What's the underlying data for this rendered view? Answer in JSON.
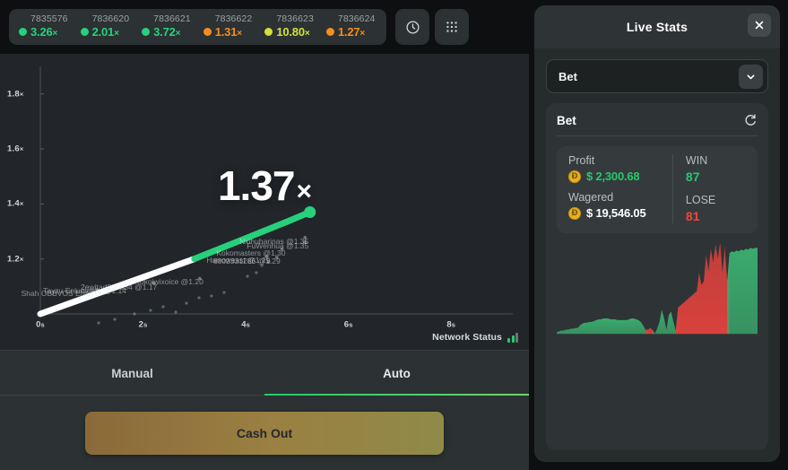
{
  "history": {
    "items": [
      {
        "id": "7835576",
        "multiplier": "3.26",
        "suffix": "×",
        "dot_color": "#27d17c",
        "text_color": "#27d17c"
      },
      {
        "id": "7836620",
        "multiplier": "2.01",
        "suffix": "×",
        "dot_color": "#27d17c",
        "text_color": "#27d17c"
      },
      {
        "id": "7836621",
        "multiplier": "3.72",
        "suffix": "×",
        "dot_color": "#27d17c",
        "text_color": "#27d17c"
      },
      {
        "id": "7836622",
        "multiplier": "1.31",
        "suffix": "×",
        "dot_color": "#f58e1f",
        "text_color": "#f58e1f"
      },
      {
        "id": "7836623",
        "multiplier": "10.80",
        "suffix": "×",
        "dot_color": "#cfe03a",
        "text_color": "#cfe03a"
      },
      {
        "id": "7836624",
        "multiplier": "1.27",
        "suffix": "×",
        "dot_color": "#f58e1f",
        "text_color": "#f58e1f"
      }
    ],
    "history_icon": "clock-icon",
    "grid_icon": "grid-dots-icon"
  },
  "chart_data": {
    "type": "line",
    "title": "1.37×",
    "current_multiplier": "1.37",
    "multiplier_suffix": "×",
    "xlabel": "",
    "ylabel": "",
    "x_ticks": [
      "0s",
      "2s",
      "4s",
      "6s",
      "8s"
    ],
    "x_tick_values": [
      0,
      2,
      4,
      6,
      8
    ],
    "y_ticks": [
      "1.2×",
      "1.4×",
      "1.6×",
      "1.8×"
    ],
    "y_tick_values": [
      1.2,
      1.4,
      1.6,
      1.8
    ],
    "xlim": [
      0,
      9.2
    ],
    "ylim": [
      1.0,
      1.9
    ],
    "grid": false,
    "series": [
      {
        "name": "multiplier-curve",
        "color": "#27d17c",
        "x": [
          0,
          0.6,
          1.2,
          1.8,
          2.4,
          3.0,
          3.6,
          4.2,
          4.8,
          5.25
        ],
        "y": [
          1.0,
          1.04,
          1.08,
          1.12,
          1.16,
          1.2,
          1.245,
          1.29,
          1.335,
          1.37
        ]
      }
    ],
    "cashouts": [
      {
        "label": "Nxihuharinas @1.35",
        "x": 5.05,
        "y": 1.265
      },
      {
        "label": "FuWenhua @1.35",
        "x": 5.05,
        "y": 1.248
      },
      {
        "label": "Kokomasters @1.30",
        "x": 4.6,
        "y": 1.222
      },
      {
        "label": "Harroweast @1.29",
        "x": 4.3,
        "y": 1.196
      },
      {
        "label": "8802331286 @1.29",
        "x": 4.5,
        "y": 1.193
      },
      {
        "label": "Kokoiwixoice @1.20",
        "x": 3.0,
        "y": 1.116
      },
      {
        "label": "2ewitad200034 @1.17",
        "x": 2.1,
        "y": 1.099
      },
      {
        "label": "Tayzu Enlumotoq @1.14",
        "x": 1.5,
        "y": 1.086
      },
      {
        "label": "Shah OBBVOS EN6TO",
        "x": 1.0,
        "y": 1.075
      }
    ]
  },
  "network": {
    "label": "Network Status",
    "bars_active": 2,
    "bars_total": 3
  },
  "bottom": {
    "tabs": [
      {
        "label": "Manual",
        "active": false
      },
      {
        "label": "Auto",
        "active": true
      }
    ],
    "action_button": "Cash Out"
  },
  "live_stats": {
    "title": "Live Stats",
    "close_icon": "close-icon",
    "select": {
      "value": "Bet",
      "caret_icon": "chevron-down-icon"
    },
    "card": {
      "title": "Bet",
      "refresh_icon": "refresh-icon",
      "profit_label": "Profit",
      "profit_value": "$ 2,300.68",
      "profit_currency": "Đ",
      "wagered_label": "Wagered",
      "wagered_value": "$ 19,546.05",
      "wagered_currency": "Đ",
      "win_label": "WIN",
      "win_value": "87",
      "lose_label": "LOSE",
      "lose_value": "81"
    },
    "sparkline": {
      "type": "area",
      "positive_color": "#3aab6d",
      "negative_color": "#d9413c",
      "values": [
        0.02,
        0.03,
        0.04,
        0.04,
        0.05,
        0.05,
        0.06,
        0.06,
        0.07,
        0.07,
        0.1,
        0.12,
        0.13,
        0.13,
        0.14,
        0.14,
        0.15,
        0.16,
        0.17,
        0.17,
        0.18,
        0.18,
        0.18,
        0.17,
        0.17,
        0.17,
        0.16,
        0.16,
        0.16,
        0.16,
        0.16,
        0.17,
        0.18,
        0.18,
        0.17,
        0.16,
        0.14,
        0.1,
        0.05,
        -0.04,
        -0.06,
        -0.04,
        0.0,
        0.06,
        0.14,
        0.28,
        0.18,
        0.05,
        0.22,
        0.26,
        0.14,
        0.04,
        -0.26,
        -0.28,
        -0.3,
        -0.32,
        -0.34,
        -0.36,
        -0.38,
        -0.4,
        -0.42,
        -0.6,
        -0.48,
        -0.52,
        -0.78,
        -0.62,
        -0.84,
        -0.7,
        -0.88,
        -0.74,
        -0.9,
        -0.6,
        -0.86,
        -0.52,
        0.94,
        0.96,
        0.95,
        0.97,
        0.96,
        0.98,
        0.97,
        0.99,
        0.98,
        1.0,
        0.99,
        1.0,
        1.0
      ]
    }
  }
}
